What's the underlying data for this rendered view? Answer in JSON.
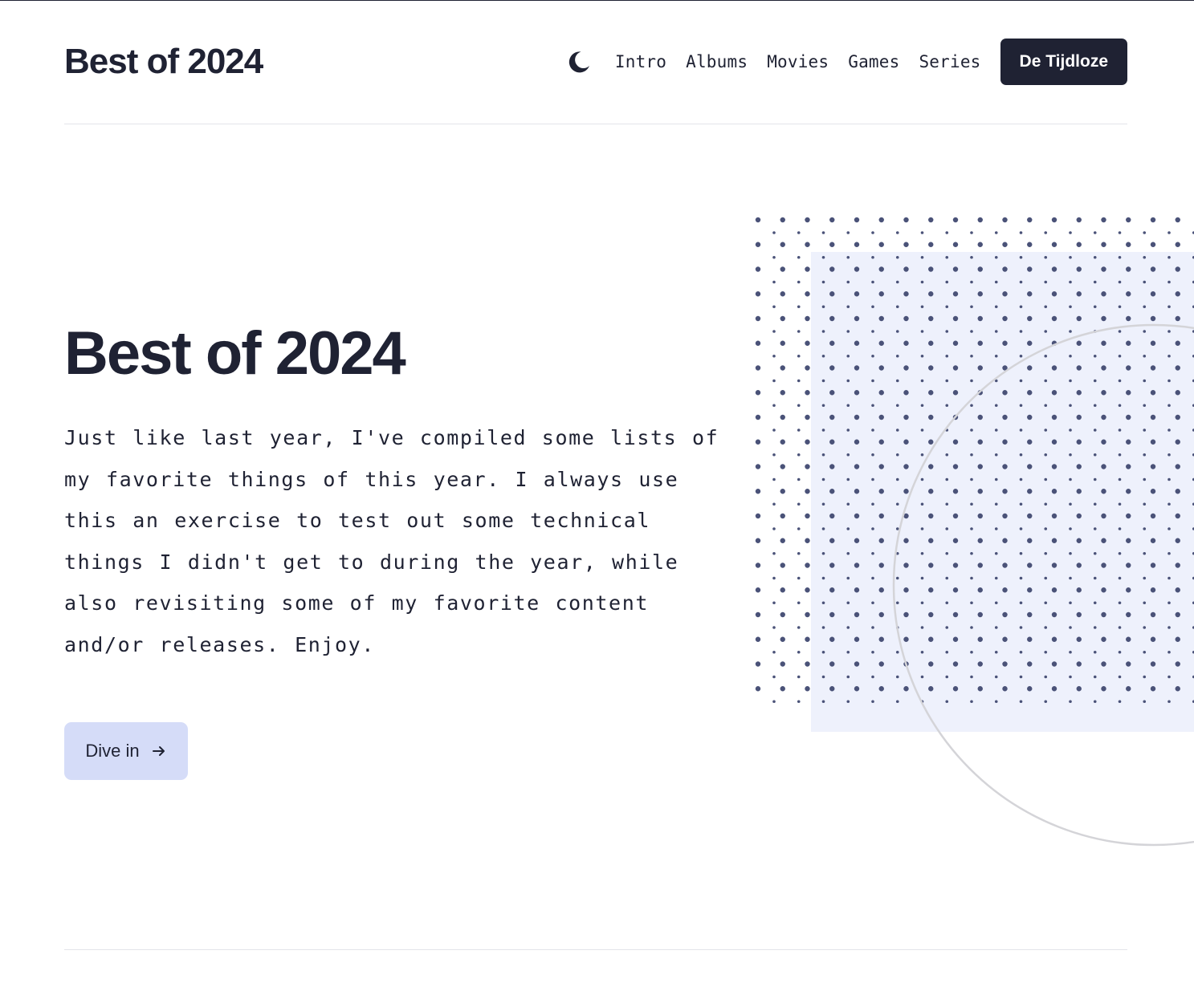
{
  "header": {
    "site_title": "Best of 2024",
    "theme_toggle_icon": "moon-icon",
    "nav": [
      {
        "label": "Intro"
      },
      {
        "label": "Albums"
      },
      {
        "label": "Movies"
      },
      {
        "label": "Games"
      },
      {
        "label": "Series"
      }
    ],
    "cta_label": "De Tijdloze"
  },
  "hero": {
    "title": "Best of 2024",
    "text": "Just like last year, I've compiled some lists of my favorite things of this year. I always use this an exercise to test out some technical things I didn't get to during the year, while also revisiting some of my favorite content and/or releases. Enjoy.",
    "button_label": "Dive in",
    "button_icon": "arrow-right-icon"
  },
  "colors": {
    "text": "#1f2233",
    "cta_background": "#1f2233",
    "button_background": "#d5dcf8",
    "art_panel": "#eef1fc",
    "dots": "#4a5278",
    "circle": "#d4d4d8",
    "rule": "#e3e4ea"
  }
}
